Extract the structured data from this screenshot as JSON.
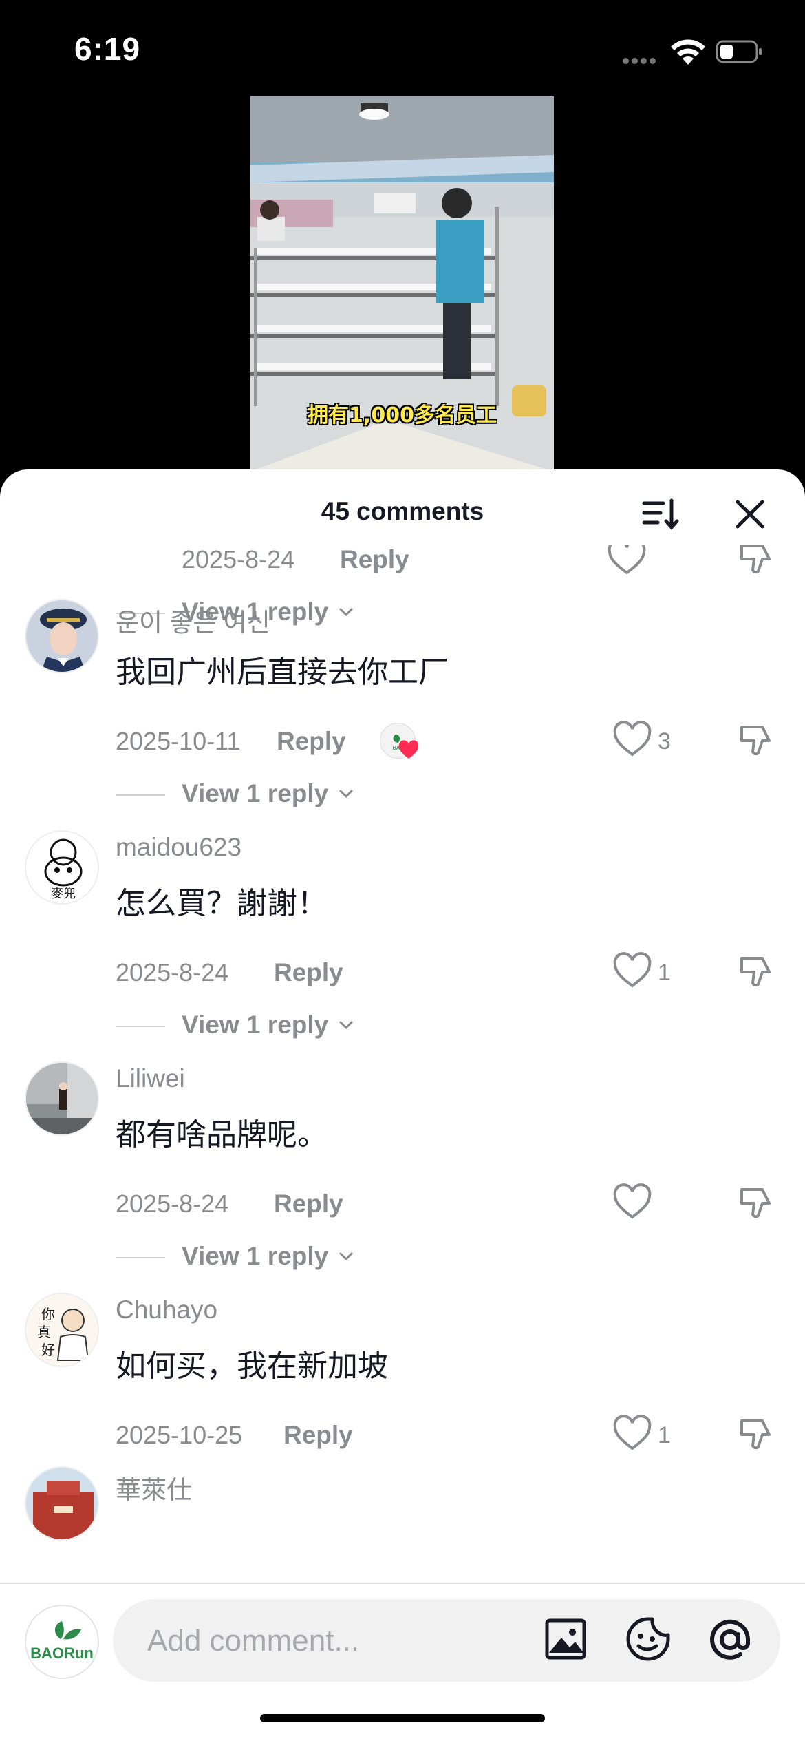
{
  "status_bar": {
    "time": "6:19"
  },
  "video": {
    "caption": "拥有1,000多名员工"
  },
  "sheet": {
    "title": "45 comments"
  },
  "partial_comment": {
    "date": "2025-8-24",
    "reply_label": "Reply",
    "view_replies": "View 1 reply"
  },
  "comments": [
    {
      "username": "운이 좋은 여신",
      "text": "我回广州后直接去你工厂",
      "date": "2025-10-11",
      "reply_label": "Reply",
      "likes": "3",
      "view_replies": "View 1 reply",
      "creator_liked": true
    },
    {
      "username": "maidou623",
      "text": "怎么買？謝謝！",
      "date": "2025-8-24",
      "reply_label": "Reply",
      "likes": "1",
      "view_replies": "View 1 reply"
    },
    {
      "username": "Liliwei",
      "text": "都有啥品牌呢。",
      "date": "2025-8-24",
      "reply_label": "Reply",
      "likes": "",
      "view_replies": "View 1 reply"
    },
    {
      "username": "Chuhayo",
      "text": "如何买，我在新加坡",
      "date": "2025-10-25",
      "reply_label": "Reply",
      "likes": "1"
    },
    {
      "username": "華萊仕"
    }
  ],
  "composer": {
    "placeholder": "Add comment...",
    "avatar_logo": "BAORun"
  },
  "colors": {
    "text_primary": "#161823",
    "text_secondary": "#8a8b91",
    "input_bg": "#f1f1f2",
    "heart_red": "#fe2c55"
  },
  "icons": [
    "wifi-icon",
    "battery-icon",
    "sort-icon",
    "close-icon",
    "heart-icon",
    "dislike-icon",
    "chevron-down-icon",
    "image-icon",
    "sticker-icon",
    "at-icon"
  ]
}
